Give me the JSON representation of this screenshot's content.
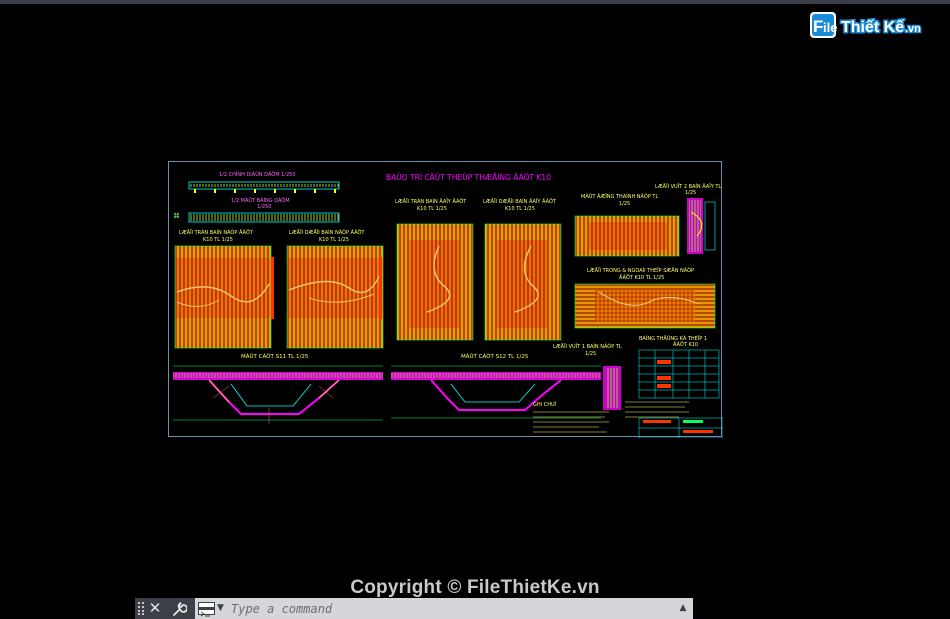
{
  "watermark": {
    "logo_text": "File Thiết Kế",
    "logo_suffix": ".vn",
    "copyright": "Copyright © FileThietKe.vn"
  },
  "drawing": {
    "title": "BAÛO TRÌ CÄÛT THEÙP THÆÅÌNG ÄÁÖT K10",
    "labels": {
      "elev_top": "1/2 CHÍNH DIÃÛN DÁÖM 1/250",
      "elev_bottom": "1/2 MÀÛT BÀÌNG DÁÖM",
      "elev_scale": "1/250",
      "panel1": "LÆÅÏI TRÃN BAÍN NÀÕP ÄÁÖT",
      "panel1_scale": "K10 TL 1/25",
      "panel2": "LÆÅÏI DÆÅÏI BAÍN NÀÕP ÄÁÖT",
      "panel2_scale": "K10 TL 1/25",
      "panel3": "LÆÅÏI TRÃN BAÍN ÂAÏY ÄÁÖT",
      "panel3_scale": "K10 TL 1/25",
      "panel4": "LÆÅÏI DÆÅÏI BAÍN ÂAÏY ÄÁÖT",
      "panel4_scale": "K10 TL 1/25",
      "panel5": "MÀÛT ÂÆÏNG THAÌNH NÀÕP TL",
      "panel5_scale": "1/25",
      "panel6": "LÆÅÏI TRONG & NGOAÌI THEÏP SÆÅN NÀÕP",
      "panel6_scale": "ÄÁÖT K10 TL 1/25",
      "right_top": "LÆÅÏI VUÏT 2 BAÍN ÂAÏY TL",
      "right_top_scale": "1/25",
      "right_mid": "LÆÅÏI VUÏT 1 BAÍN NÀÕP TL",
      "right_mid_scale": "1/25",
      "section1": "MÀÛT CÀÕT S11 TL 1/25",
      "section2": "MÀÛT CÀÕT S12 TL 1/25",
      "table_title": "BAÍNG THÄÚNG KÃ THEÏP 1",
      "table_sub": "ÄÁÖT K10",
      "notes_title": "GHI CHUÏ"
    }
  },
  "command_line": {
    "placeholder": "Type a command",
    "close_glyph": "✕",
    "dropdown_glyph": "▼",
    "history_glyph": "▲"
  },
  "colors": {
    "background": "#000000",
    "sheet_border": "#6f8faf",
    "rebar_yellow": "#ffff00",
    "rebar_red": "#ff3b00",
    "rebar_orange": "#ff9900",
    "magenta": "#ff00ff",
    "green": "#00ff00",
    "cyan": "#00ffff",
    "command_bar": "#d4d6da",
    "logo_blue": "#1a8bd6"
  }
}
